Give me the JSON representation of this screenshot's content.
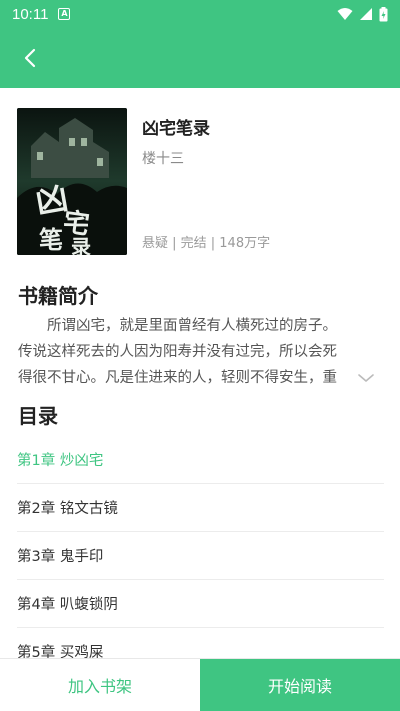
{
  "status_bar": {
    "time": "10:11",
    "a_badge": "A"
  },
  "colors": {
    "accent": "#3fc582",
    "text_primary": "#222222",
    "text_secondary": "#8a8a8a"
  },
  "header": {
    "back_icon": "chevron-left-icon"
  },
  "book": {
    "title": "凶宅笔录",
    "author": "楼十三",
    "meta": "悬疑 | 完结 | 148万字",
    "cover_text": "凶宅笔录"
  },
  "intro": {
    "heading": "书籍简介",
    "text": "所谓凶宅，就是里面曾经有人横死过的房子。传说这样死去的人因为阳寿并没有过完，所以会死得很不甘心。凡是住进来的人，轻则不得安生，重则家破…"
  },
  "toc": {
    "heading": "目录",
    "items": [
      {
        "label": "第1章 炒凶宅"
      },
      {
        "label": "第2章 铭文古镜"
      },
      {
        "label": "第3章 鬼手印"
      },
      {
        "label": "第4章 叭蝮锁阴"
      },
      {
        "label": "第5章 买鸡屎"
      }
    ]
  },
  "actions": {
    "add_shelf": "加入书架",
    "start_read": "开始阅读"
  }
}
